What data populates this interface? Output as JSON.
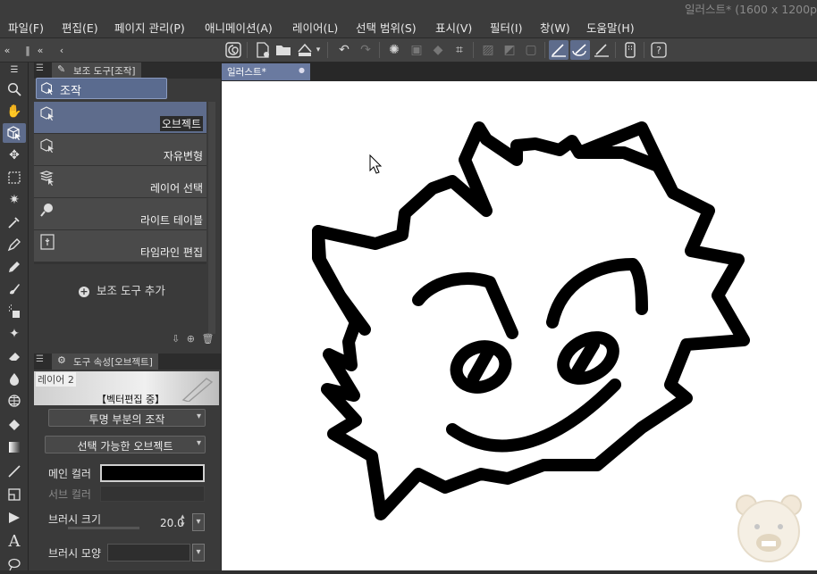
{
  "menu": {
    "items": [
      {
        "label": "파일(F)"
      },
      {
        "label": "편집(E)"
      },
      {
        "label": "페이지 관리(P)"
      },
      {
        "label": "애니메이션(A)"
      },
      {
        "label": "레이어(L)"
      },
      {
        "label": "선택 범위(S)"
      },
      {
        "label": "표시(V)"
      },
      {
        "label": "필터(I)"
      },
      {
        "label": "창(W)"
      },
      {
        "label": "도움말(H)"
      }
    ],
    "app_title": "일러스트* (1600 x 1200p"
  },
  "sub_tool": {
    "tab_label": "보조 도구[조작]",
    "group_label": "조작",
    "items": [
      {
        "label": "오브젝트"
      },
      {
        "label": "자유변형"
      },
      {
        "label": "레이어 선택"
      },
      {
        "label": "라이트 테이블"
      },
      {
        "label": "타임라인 편집"
      }
    ],
    "add_label": "보조 도구 추가"
  },
  "tool_property": {
    "tab_label": "도구 속성[오브젝트]",
    "preview_layer": "레이어 2",
    "preview_state": "【벡터편집 중】",
    "transparent_op": "투명 부분의 조작",
    "selectable": "선택 가능한 오브젝트",
    "main_color_label": "메인 컬러",
    "main_color": "#000000",
    "sub_color_label": "서브 컬러",
    "brush_size_label": "브러시 크기",
    "brush_size_value": "20.0",
    "brush_shape_label": "브러시 모양"
  },
  "document": {
    "tab_label": "일러스트*"
  },
  "colors": {
    "accent": "#5e6c8c",
    "canvas": "#ffffff",
    "panel": "#3a3a3a"
  },
  "icons": [
    "hamburger-menu-icon",
    "zoom-icon",
    "hand-icon",
    "operation-icon",
    "move-icon",
    "marquee-icon",
    "auto-select-icon",
    "eyedropper-icon",
    "pen-icon",
    "pencil-icon",
    "brush-icon",
    "airbrush-icon",
    "decoration-icon",
    "eraser-icon",
    "blend-icon",
    "fill-icon",
    "gradient-icon",
    "figure-icon",
    "frame-icon",
    "ruler-icon",
    "text-icon",
    "balloon-icon"
  ]
}
